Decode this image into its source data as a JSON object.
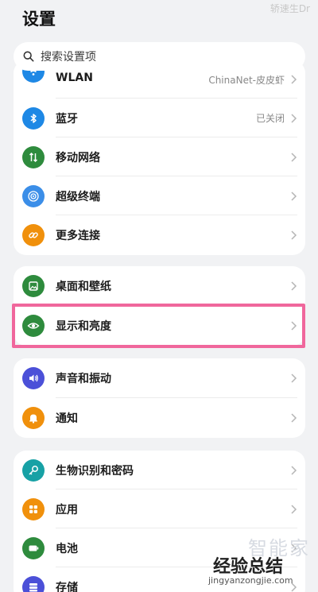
{
  "header": {
    "title": "设置",
    "watermark": "轿速生Dr"
  },
  "search": {
    "placeholder": "搜索设置项",
    "icon": "search-icon"
  },
  "groups": [
    {
      "items": [
        {
          "label": "WLAN",
          "value": "ChinaNet-皮皮虾",
          "icon": "wifi-icon",
          "color": "#1e88e5"
        },
        {
          "label": "蓝牙",
          "value": "已关闭",
          "icon": "bluetooth-icon",
          "color": "#1e88e5"
        },
        {
          "label": "移动网络",
          "value": "",
          "icon": "mobile-data-icon",
          "color": "#2e8b3d"
        },
        {
          "label": "超级终端",
          "value": "",
          "icon": "super-device-icon",
          "color": "#3b8ee8"
        },
        {
          "label": "更多连接",
          "value": "",
          "icon": "link-icon",
          "color": "#f0900c"
        }
      ]
    },
    {
      "items": [
        {
          "label": "桌面和壁纸",
          "value": "",
          "icon": "wallpaper-icon",
          "color": "#2e8b3d"
        },
        {
          "label": "显示和亮度",
          "value": "",
          "icon": "eye-icon",
          "color": "#2e8b3d"
        }
      ]
    },
    {
      "items": [
        {
          "label": "声音和振动",
          "value": "",
          "icon": "sound-icon",
          "color": "#4b50d8"
        },
        {
          "label": "通知",
          "value": "",
          "icon": "bell-icon",
          "color": "#f0900c"
        }
      ]
    },
    {
      "items": [
        {
          "label": "生物识别和密码",
          "value": "",
          "icon": "key-icon",
          "color": "#17a1a5"
        },
        {
          "label": "应用",
          "value": "",
          "icon": "apps-icon",
          "color": "#f0900c"
        },
        {
          "label": "电池",
          "value": "",
          "icon": "battery-icon",
          "color": "#2e8b3d"
        },
        {
          "label": "存储",
          "value": "",
          "icon": "storage-icon",
          "color": "#4b50d8"
        }
      ]
    }
  ],
  "watermark": {
    "line1": "智能家",
    "line2": "经验总结",
    "line3": "jingyanzongjie.com"
  }
}
